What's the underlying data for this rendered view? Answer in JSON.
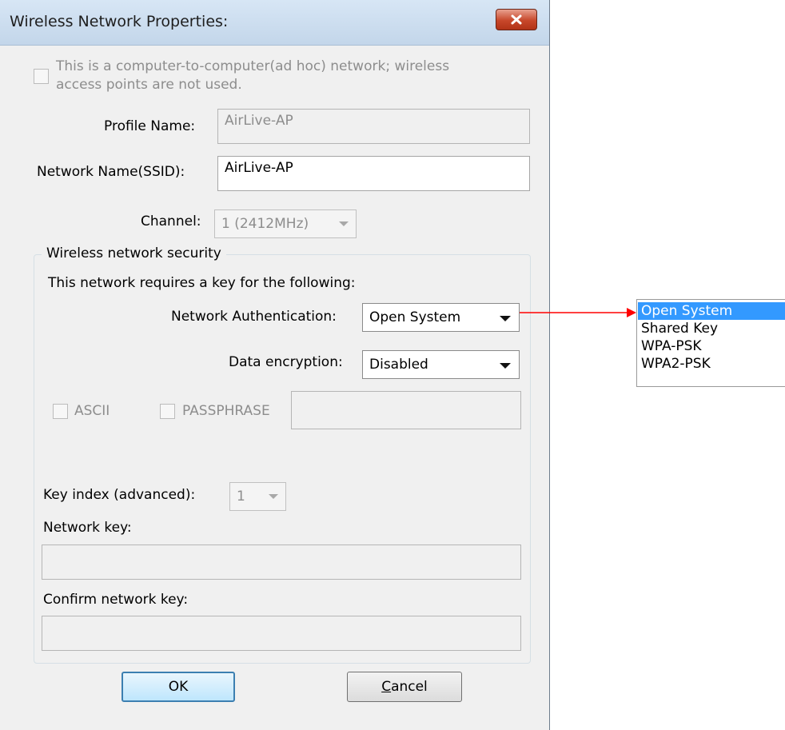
{
  "window": {
    "title": "Wireless Network Properties:",
    "close_icon": "close-x-icon"
  },
  "adhoc": {
    "label_line1": "This is a computer-to-computer(ad hoc) network; wireless",
    "label_line2": "access points are not used.",
    "checked": false
  },
  "profile": {
    "label": "Profile Name:",
    "value": "AirLive-AP"
  },
  "ssid": {
    "label": "Network Name(SSID):",
    "value": "AirLive-AP"
  },
  "channel": {
    "label": "Channel:",
    "value": "1 (2412MHz)"
  },
  "security": {
    "group_title": "Wireless network security",
    "requires_text": "This network requires a key for the following:",
    "auth_label": "Network Authentication:",
    "auth_value": "Open System",
    "enc_label": "Data encryption:",
    "enc_value": "Disabled",
    "ascii_label": "ASCII",
    "passphrase_label": "PASSPHRASE",
    "passphrase_value": "",
    "key_index_label": "Key index (advanced):",
    "key_index_value": "1",
    "network_key_label": "Network key:",
    "network_key_value": "",
    "confirm_key_label": "Confirm network key:",
    "confirm_key_value": ""
  },
  "buttons": {
    "ok": "OK",
    "cancel_prefix": "C",
    "cancel_rest": "ancel"
  },
  "auth_dropdown": {
    "options": [
      "Open System",
      "Shared Key",
      "WPA-PSK",
      "WPA2-PSK"
    ],
    "selected": "Open System"
  },
  "colors": {
    "annotation_arrow": "#ff0000",
    "selection": "#3399ff"
  }
}
